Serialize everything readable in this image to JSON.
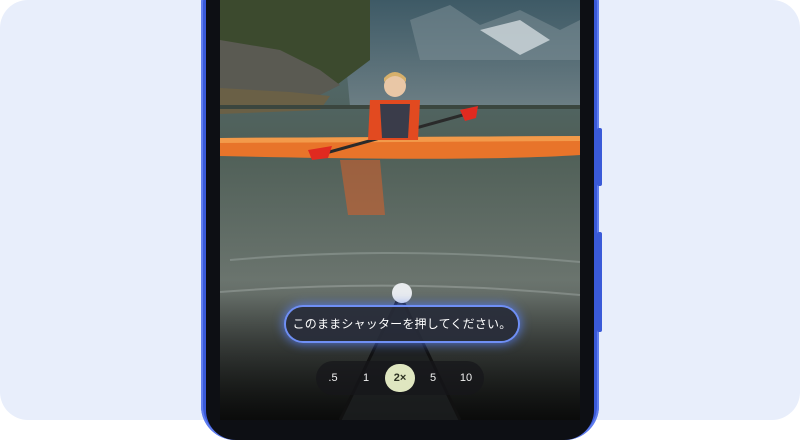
{
  "camera": {
    "hint_text": "このままシャッターを押してください。",
    "zoom_levels": [
      {
        "label": ".5",
        "active": false
      },
      {
        "label": "1",
        "active": false
      },
      {
        "label": "2×",
        "active": true
      },
      {
        "label": "5",
        "active": false
      },
      {
        "label": "10",
        "active": false
      }
    ]
  },
  "colors": {
    "background": "#e8eefb",
    "phone_body": "#3a5ad8",
    "hint_glow": "#6f8ff5",
    "active_zoom": "#dfe6c0"
  }
}
